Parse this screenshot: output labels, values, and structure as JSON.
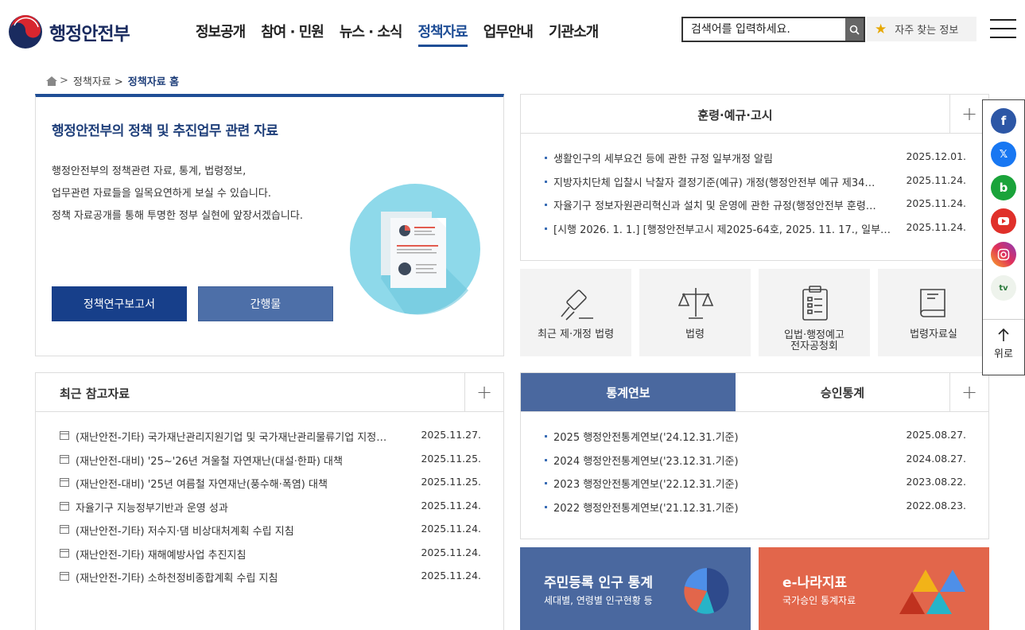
{
  "header": {
    "logo_text": "행정안전부",
    "nav": [
      "정보공개",
      "참여 · 민원",
      "뉴스 · 소식",
      "정책자료",
      "업무안내",
      "기관소개"
    ],
    "search_placeholder": "검색어를 입력하세요.",
    "favorites_label": "자주 찾는 정보"
  },
  "breadcrumb": {
    "parent": "정책자료 >",
    "current": "정책자료 홈"
  },
  "intro": {
    "title": "행정안전부의 정책 및 추진업무 관련 자료",
    "lines": [
      "행정안전부의 정책관련 자료, 통계, 법령정보,",
      "업무관련 자료들을 일목요연하게 보실 수 있습니다.",
      "정책 자료공개를 통해 투명한 정부 실현에 앞장서겠습니다."
    ],
    "btn_reports": "정책연구보고서",
    "btn_publications": "간행물"
  },
  "directives": {
    "title": "훈령·예규·고시",
    "items": [
      {
        "title": "생활인구의 세부요건 등에 관한 규정 일부개정 알림",
        "date": "2025.12.01."
      },
      {
        "title": "지방자치단체 입찰시 낙찰자 결정기준(예규) 개정(행정안전부 예규 제34…",
        "date": "2025.11.24."
      },
      {
        "title": "자율기구 정보자원관리혁신과 설치 및 운영에 관한 규정(행정안전부 훈령…",
        "date": "2025.11.24."
      },
      {
        "title": "[시행 2026. 1. 1.] [행정안전부고시 제2025-64호, 2025. 11. 17., 일부…",
        "date": "2025.11.24."
      }
    ]
  },
  "law_tiles": [
    {
      "icon": "gavel-icon",
      "label": "최근 제·개정 법령"
    },
    {
      "icon": "scales-icon",
      "label": "법령"
    },
    {
      "icon": "clipboard-icon",
      "label": "입법·행정예고\n전자공청회"
    },
    {
      "icon": "book-icon",
      "label": "법령자료실"
    }
  ],
  "references": {
    "title": "최근 참고자료",
    "items": [
      {
        "title": "(재난안전-기타) 국가재난관리지원기업 및 국가재난관리물류기업 지정…",
        "date": "2025.11.27."
      },
      {
        "title": "(재난안전-대비) '25~'26년 겨울철 자연재난(대설·한파) 대책",
        "date": "2025.11.25."
      },
      {
        "title": "(재난안전-대비) '25년 여름철 자연재난(풍수해·폭염) 대책",
        "date": "2025.11.25."
      },
      {
        "title": "자율기구 지능정부기반과 운영 성과",
        "date": "2025.11.24."
      },
      {
        "title": "(재난안전-기타) 저수지·댐 비상대처계획 수립 지침",
        "date": "2025.11.24."
      },
      {
        "title": "(재난안전-기타) 재해예방사업 추진지침",
        "date": "2025.11.24."
      },
      {
        "title": "(재난안전-기타) 소하천정비종합계획 수립 지침",
        "date": "2025.11.24."
      }
    ]
  },
  "stats": {
    "tab_active": "통계연보",
    "tab_other": "승인통계",
    "items": [
      {
        "title": "2025 행정안전통계연보('24.12.31.기준)",
        "date": "2025.08.27."
      },
      {
        "title": "2024 행정안전통계연보('23.12.31.기준)",
        "date": "2024.08.27."
      },
      {
        "title": "2023 행정안전통계연보('22.12.31.기준)",
        "date": "2023.08.22."
      },
      {
        "title": "2022 행정안전통계연보('21.12.31.기준)",
        "date": "2022.08.23."
      }
    ]
  },
  "banners": {
    "population": {
      "title": "주민등록 인구 통계",
      "sub": "세대별, 연령별 인구현황 등",
      "color": "#4a689f"
    },
    "enara": {
      "title": "e-나라지표",
      "sub": "국가승인 통계자료",
      "color": "#e2664b"
    }
  },
  "quick": {
    "sns": [
      "facebook-icon",
      "x-icon",
      "blog-icon",
      "youtube-icon",
      "instagram-icon",
      "tv-icon"
    ],
    "top_label": "위로"
  }
}
